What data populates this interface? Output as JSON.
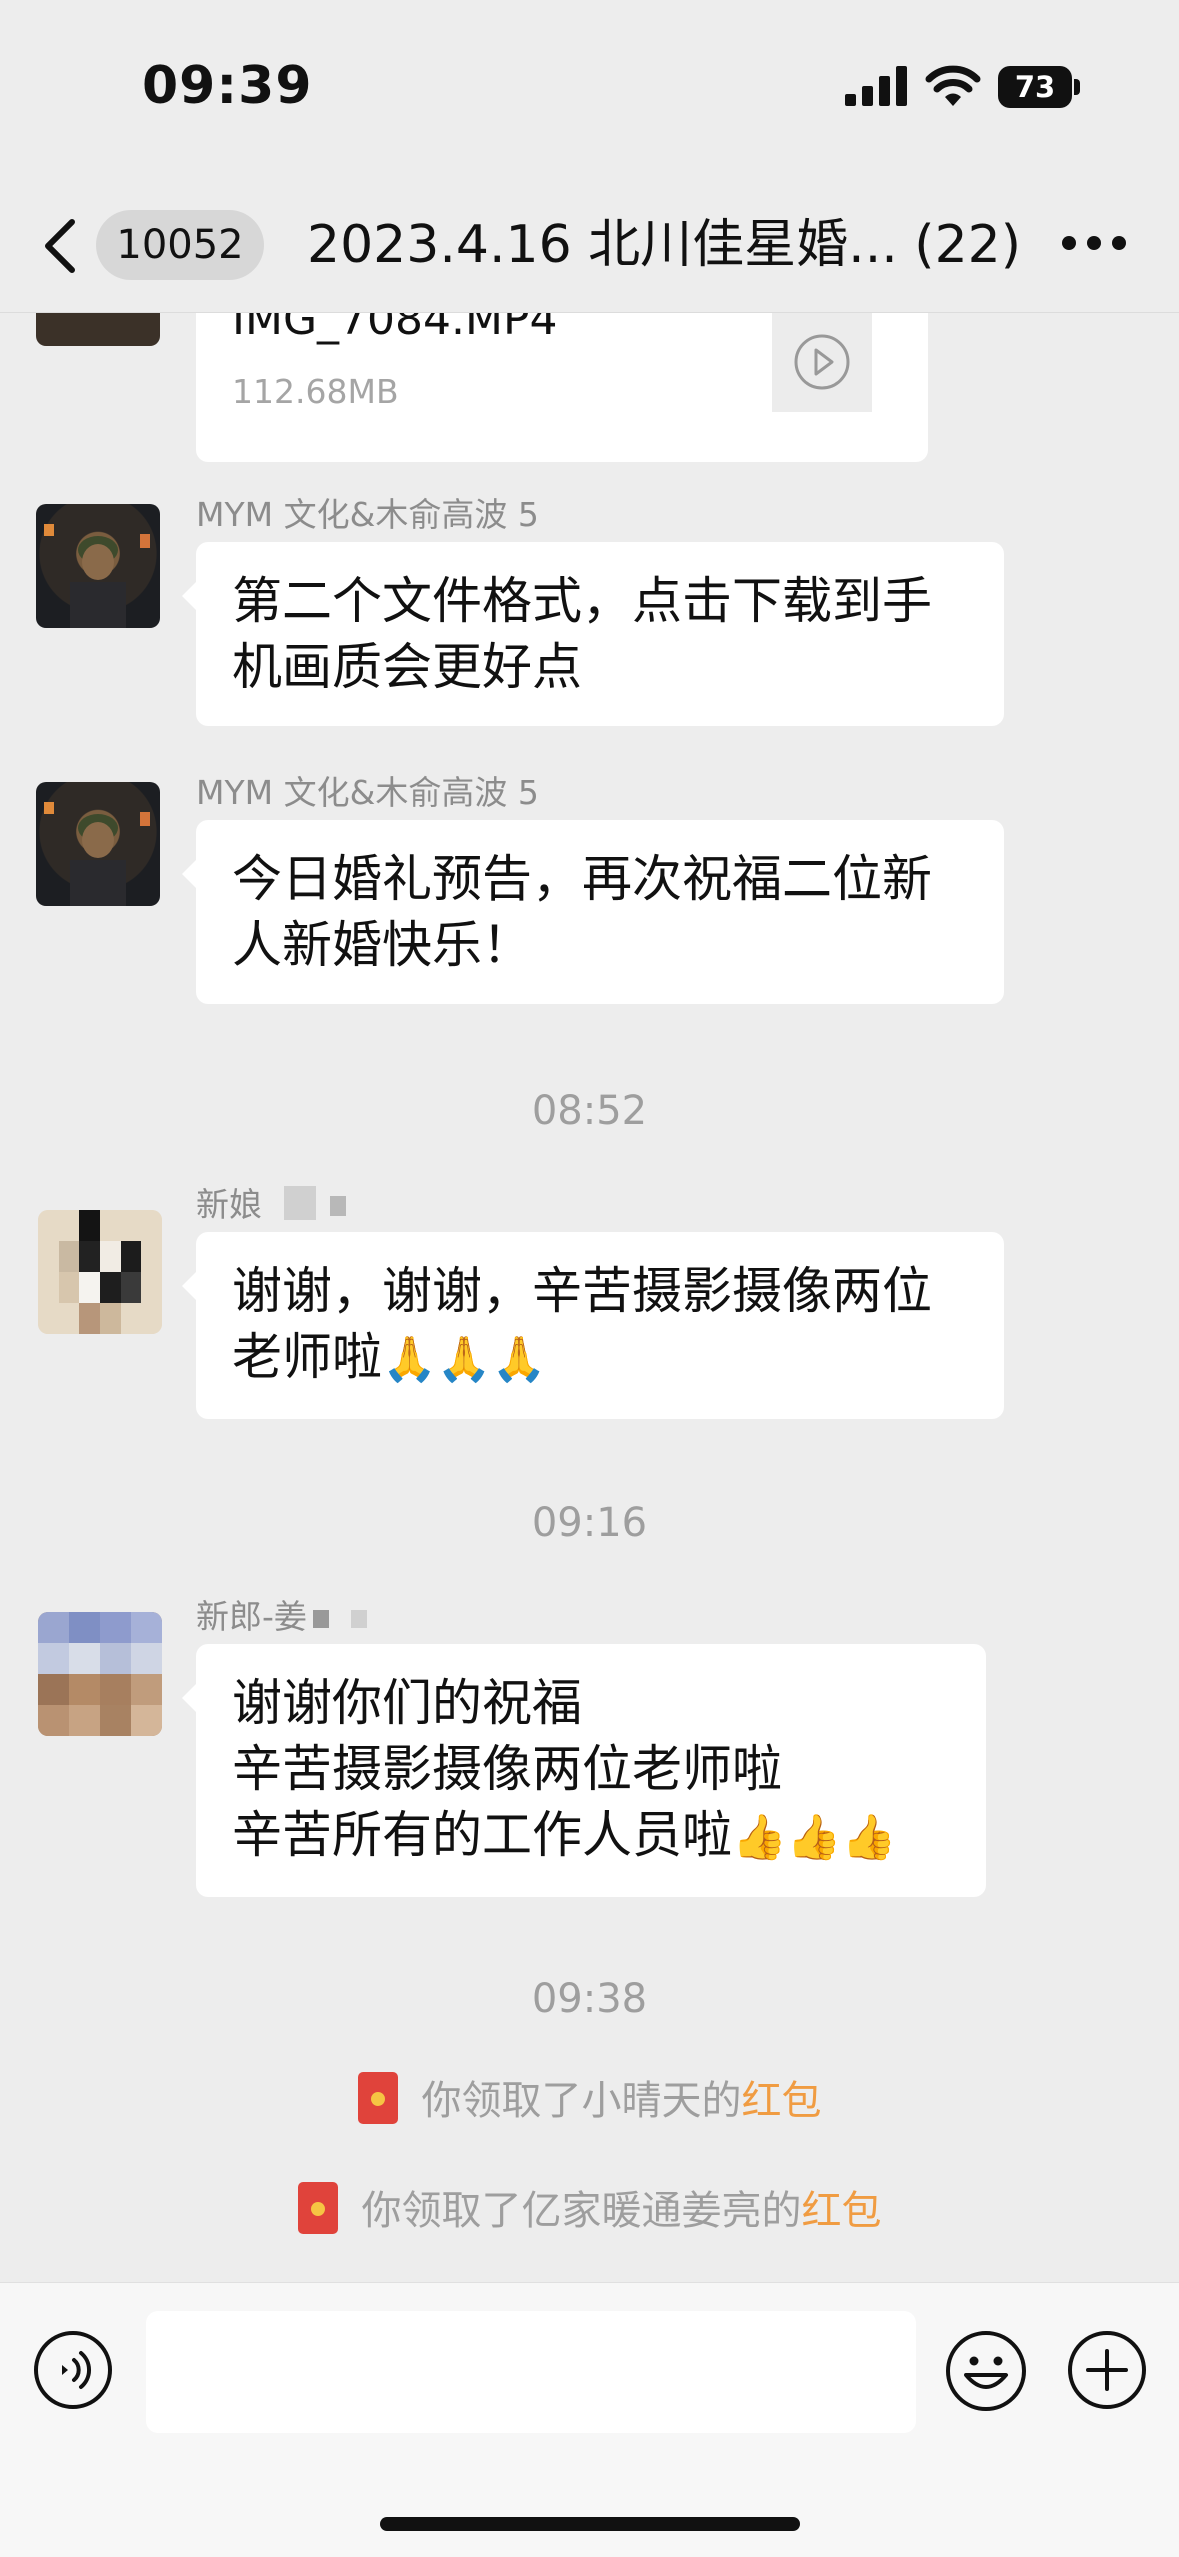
{
  "status_bar": {
    "time": "09:39",
    "battery": "73"
  },
  "nav": {
    "back_label": "back",
    "unread_count": "10052",
    "title": "2023.4.16 北川佳星婚... (22)",
    "more_label": "more"
  },
  "messages": {
    "file": {
      "name": "IMG_7084.MP4",
      "size": "112.68MB"
    },
    "msg1": {
      "sender": "MYM 文化&木俞高波 5",
      "lines": [
        "第二个文件格式，点击下载到手",
        "机画质会更好点"
      ]
    },
    "msg2": {
      "sender": "MYM 文化&木俞高波 5",
      "lines": [
        "今日婚礼预告，再次祝福二位新",
        "人新婚快乐！"
      ]
    },
    "time1": "08:52",
    "msg3": {
      "sender": "新娘",
      "lines": [
        "谢谢，谢谢，辛苦摄影摄像两位",
        "老师啦"
      ],
      "emoji": "🙏🙏🙏"
    },
    "time2": "09:16",
    "msg4": {
      "sender": "新郎-姜",
      "lines": [
        "谢谢你们的祝福",
        "辛苦摄影摄像两位老师啦",
        "辛苦所有的工作人员啦"
      ],
      "emoji": "👍👍👍"
    },
    "time3": "09:38",
    "sys1": {
      "prefix": "你领取了小晴天的",
      "link": "红包"
    },
    "sys2": {
      "prefix": "你领取了亿家暖通姜亮的",
      "link": "红包"
    }
  },
  "input": {
    "voice_icon": "voice-icon",
    "emoji_icon": "emoji-icon",
    "plus_icon": "plus-icon"
  },
  "colors": {
    "background": "#ededed",
    "bubble": "#ffffff",
    "accent_orange": "#f09c42",
    "redpack": "#e0433b"
  }
}
